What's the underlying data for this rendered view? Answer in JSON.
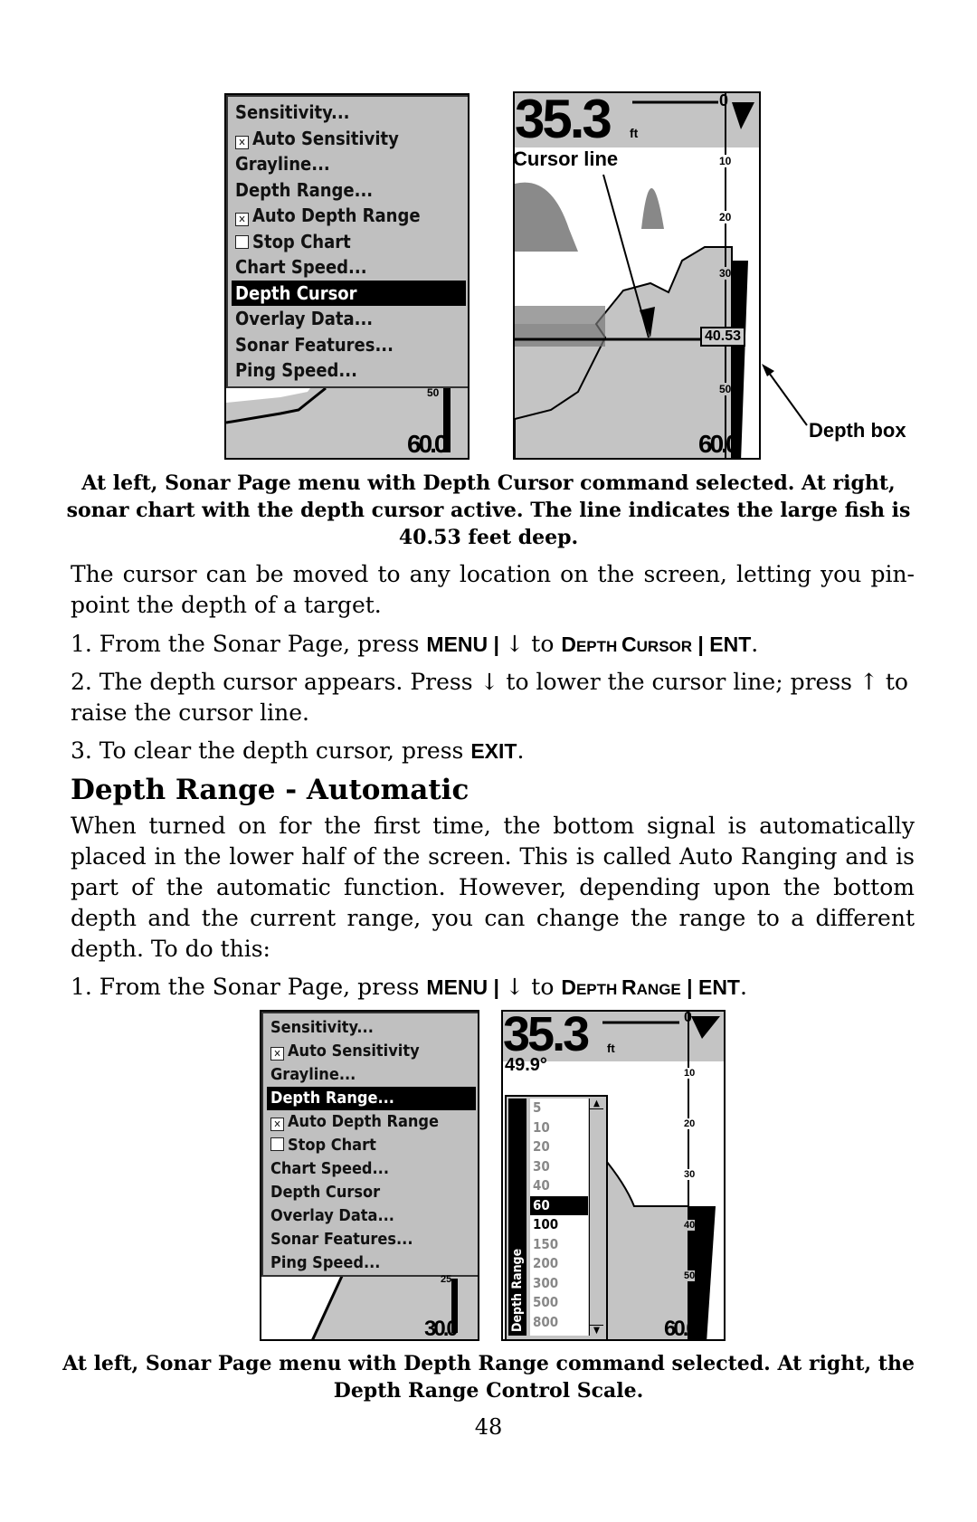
{
  "figure1": {
    "menu": [
      {
        "label": "Sensitivity...",
        "check": null
      },
      {
        "label": "Auto Sensitivity",
        "check": "checked"
      },
      {
        "label": "Grayline...",
        "check": null
      },
      {
        "label": "Depth Range...",
        "check": null
      },
      {
        "label": "Auto Depth Range",
        "check": "checked"
      },
      {
        "label": "Stop Chart",
        "check": "unchecked"
      },
      {
        "label": "Chart Speed...",
        "check": null
      },
      {
        "label": "Depth Cursor",
        "check": null,
        "selected": true
      },
      {
        "label": "Overlay Data...",
        "check": null
      },
      {
        "label": "Sonar Features...",
        "check": null
      },
      {
        "label": "Ping Speed...",
        "check": null
      }
    ],
    "left_scale_top": "50",
    "left_range": "60.0",
    "depth": "35.3",
    "depth_unit": "ft",
    "right_scale": [
      "0",
      "10",
      "20",
      "30",
      "50"
    ],
    "right_range": "60.0",
    "cursor_label": "Cursor line",
    "depth_box_value": "40.53",
    "depth_box_label": "Depth box",
    "caption": "At left, Sonar Page menu with Depth Cursor command selected. At right, sonar chart with the depth cursor active. The line indicates the large fish is 40.53 feet deep."
  },
  "text": {
    "p1": "The cursor can be moved to any location on the screen, letting you pin-point the depth of a target.",
    "s1a": "1. From the Sonar Page, press ",
    "menu": "MENU",
    "sep": " | ",
    "down": "↓",
    "to": " to ",
    "dc_D": "D",
    "dc_rest1": "EPTH ",
    "dc_C": "C",
    "dc_rest2": "URSOR",
    "ent": "ENT",
    "dot": ".",
    "s2a": "2. The depth cursor appears. Press ",
    "s2b": " to lower the cursor line; press ",
    "up": "↑",
    "s2c": " to raise the cursor line.",
    "s3a": "3. To clear the depth cursor, press ",
    "exit": "EXIT",
    "heading": "Depth Range - Automatic",
    "p2": "When turned on for the first time, the bottom signal is automatically placed in the lower half of the screen. This is called Auto Ranging and is part of the automatic function. However, depending upon the bottom depth and the current range, you can change the range to a different depth. To do this:",
    "dr_R": "R",
    "dr_rest": "ANGE"
  },
  "figure2": {
    "menu": [
      {
        "label": "Sensitivity...",
        "check": null
      },
      {
        "label": "Auto Sensitivity",
        "check": "checked"
      },
      {
        "label": "Grayline...",
        "check": null
      },
      {
        "label": "Depth Range...",
        "check": null,
        "selected": true
      },
      {
        "label": "Auto Depth Range",
        "check": "checked"
      },
      {
        "label": "Stop Chart",
        "check": "unchecked"
      },
      {
        "label": "Chart Speed...",
        "check": null
      },
      {
        "label": "Depth Cursor",
        "check": null
      },
      {
        "label": "Overlay Data...",
        "check": null
      },
      {
        "label": "Sonar Features...",
        "check": null
      },
      {
        "label": "Ping Speed...",
        "check": null
      }
    ],
    "left_scale_top": "25",
    "left_range": "30.0",
    "depth": "35.3",
    "depth_unit": "ft",
    "temperature": "49.9°",
    "right_scale": [
      "0",
      "10",
      "20",
      "30",
      "40",
      "50"
    ],
    "right_range": "60.0",
    "range_title": "Depth Range",
    "range_options": [
      "5",
      "10",
      "20",
      "30",
      "40",
      "60",
      "100",
      "150",
      "200",
      "300",
      "500",
      "800"
    ],
    "range_selected": "60",
    "caption": "At left, Sonar Page menu with Depth Range command selected. At right, the Depth Range Control Scale."
  },
  "page_number": "48"
}
